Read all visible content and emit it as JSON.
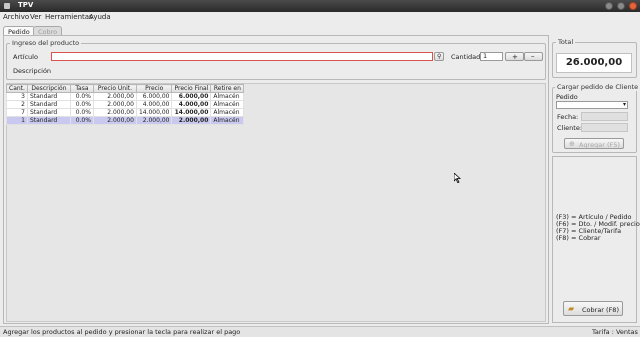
{
  "window": {
    "title": "TPV"
  },
  "menu": [
    "Archivo",
    "Ver",
    "Herramientas",
    "Ayuda"
  ],
  "tabs": {
    "pedido": "Pedido",
    "cobro": "Cobro"
  },
  "product_entry": {
    "legend": "Ingreso del producto",
    "articulo_label": "Artículo",
    "articulo_value": "",
    "cantidad_label": "Cantidad",
    "cantidad_value": "1",
    "descripcion_label": "Descripción"
  },
  "table": {
    "headers": [
      "Cant.",
      "Descripción",
      "Tasa",
      "Precio Unit.",
      "Precio",
      "Precio Final",
      "Retire en"
    ],
    "rows": [
      {
        "cant": "3",
        "descripcion": "Standard",
        "tasa": "0.0%",
        "precio_unit": "2.000,00",
        "precio": "6.000,00",
        "precio_final": "6.000,00",
        "retire": "Almacén"
      },
      {
        "cant": "2",
        "descripcion": "Standard",
        "tasa": "0.0%",
        "precio_unit": "2.000,00",
        "precio": "4.000,00",
        "precio_final": "4.000,00",
        "retire": "Almacén"
      },
      {
        "cant": "7",
        "descripcion": "Standard",
        "tasa": "0.0%",
        "precio_unit": "2.000,00",
        "precio": "14.000,00",
        "precio_final": "14.000,00",
        "retire": "Almacén"
      },
      {
        "cant": "1",
        "descripcion": "Standard",
        "tasa": "0.0%",
        "precio_unit": "2.000,00",
        "precio": "2.000,00",
        "precio_final": "2.000,00",
        "retire": "Almacén"
      }
    ]
  },
  "total": {
    "legend": "Total",
    "value": "26.000,00"
  },
  "load_order": {
    "legend": "Cargar pedido de Cliente",
    "pedido_label": "Pedido",
    "fecha_label": "Fecha:",
    "cliente_label": "Cliente:",
    "agregar_button": "Agregar (F5)"
  },
  "shortcuts": [
    "(F3) = Artículo / Pedido",
    "(F6) = Dto. / Modif. precio",
    "(F7) = Cliente/Tarifa",
    "(F8) = Cobrar"
  ],
  "cobrar_button": "Cobrar (F8)",
  "status": {
    "message": "Agregar los productos al pedido y presionar la tecla para realizar el pago",
    "right": "Tarifa : Ventas"
  }
}
